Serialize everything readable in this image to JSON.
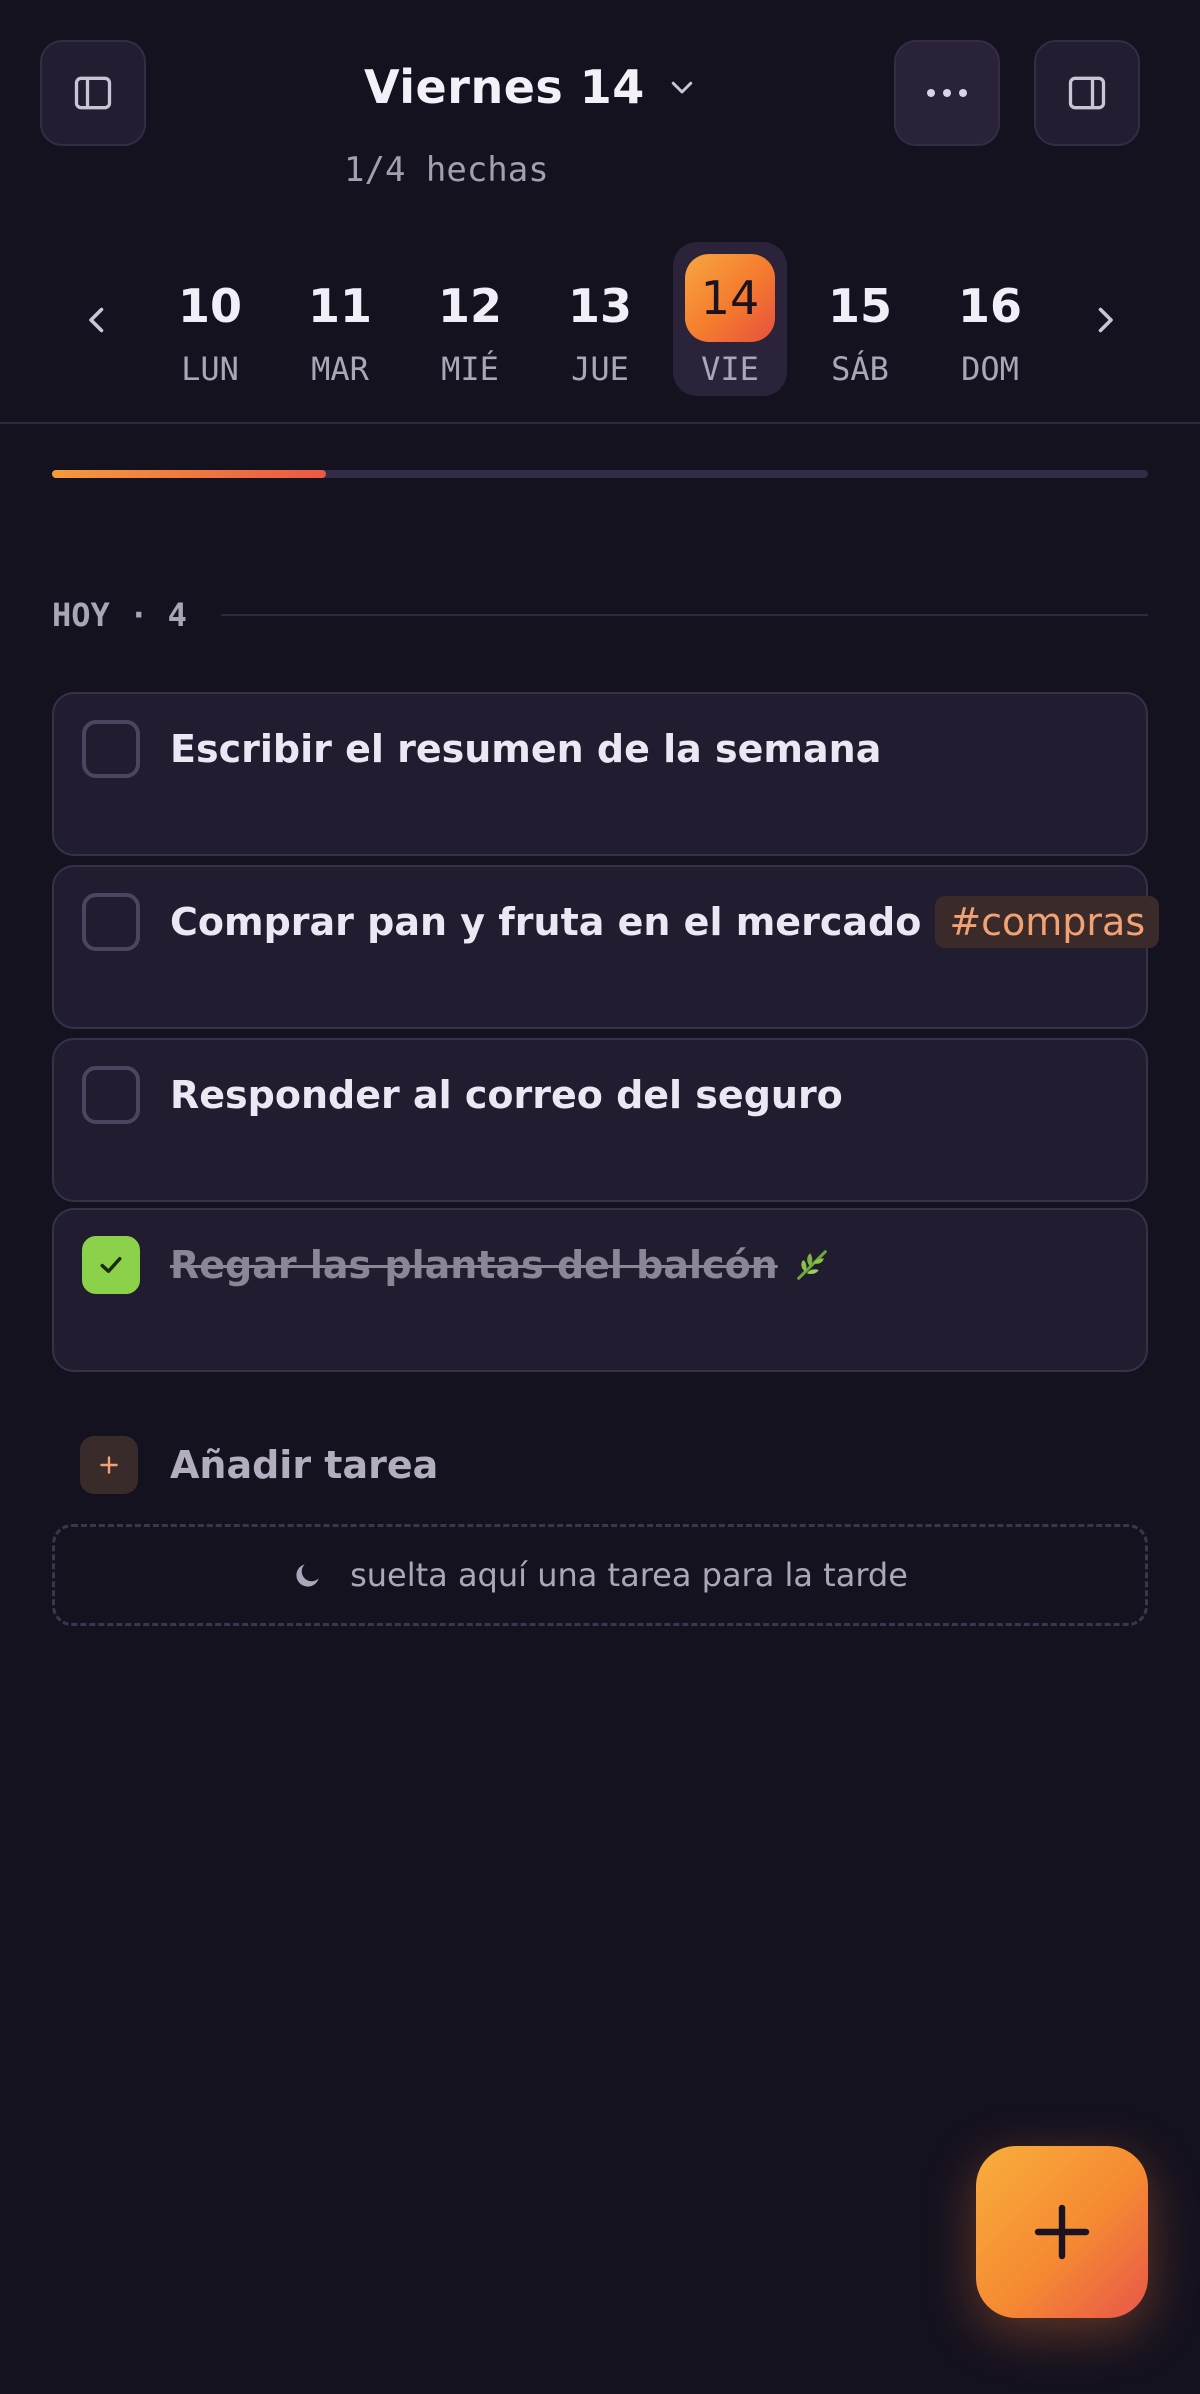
{
  "header": {
    "title": "Viernes 14",
    "subtitle": "1/4 hechas",
    "left_button_icon": "sidebar-left-icon",
    "more_button_icon": "more-horizontal-icon",
    "right_button_icon": "sidebar-right-icon",
    "title_dropdown_icon": "chevron-down-icon"
  },
  "week": {
    "prev_icon": "chevron-left-icon",
    "next_icon": "chevron-right-icon",
    "selected_index": 4,
    "days": [
      {
        "num": "10",
        "label": "LUN"
      },
      {
        "num": "11",
        "label": "MAR"
      },
      {
        "num": "12",
        "label": "MIÉ"
      },
      {
        "num": "13",
        "label": "JUE"
      },
      {
        "num": "14",
        "label": "VIE"
      },
      {
        "num": "15",
        "label": "SÁB"
      },
      {
        "num": "16",
        "label": "DOM"
      }
    ]
  },
  "progress": {
    "done": 1,
    "total": 4,
    "fraction": 0.25,
    "color_start": "#f49a3c",
    "color_end": "#ea5845"
  },
  "section": {
    "title": "HOY · 4"
  },
  "tasks": [
    {
      "text": "Escribir el resumen de la semana",
      "done": false
    },
    {
      "text": "Comprar pan y fruta en el mercado",
      "tag": "#compras",
      "done": false
    },
    {
      "text": "Responder al correo del seguro",
      "done": false
    },
    {
      "text": "Regar las plantas del balcón",
      "icon": "leaf-icon",
      "done": true
    }
  ],
  "add_task": {
    "label": "Añadir tarea",
    "icon": "plus-icon"
  },
  "dropzone": {
    "text": "suelta aquí una tarea para la tarde",
    "icon": "moon-icon"
  },
  "fab": {
    "icon": "plus-icon"
  },
  "colors": {
    "background": "#15121f",
    "card": "#211c2f",
    "accent_orange": "#f58a32",
    "accent_red": "#e9564a",
    "check_green": "#8bd14a",
    "tag_text": "#f2a173"
  }
}
